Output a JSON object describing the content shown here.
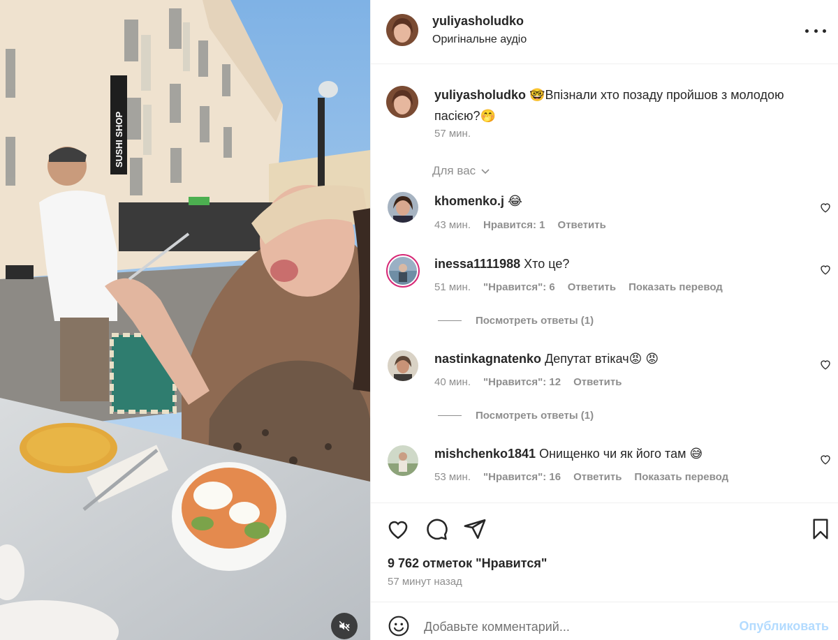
{
  "media": {
    "shop_sign": "SUSHI SHOP",
    "mute_icon": "speaker-muted-icon"
  },
  "header": {
    "username": "yuliyasholudko",
    "audio": "Оригінальне аудіо",
    "more_icon": "more-horizontal-icon"
  },
  "caption": {
    "username": "yuliyasholudko",
    "text": "🤓Впізнали хто позаду пройшов з молодою пасією?🤭",
    "time": "57 мин."
  },
  "for_you_label": "Для вас",
  "comments": [
    {
      "username": "khomenko.j",
      "text": "😂",
      "time": "43 мин.",
      "likes": "Нравится: 1",
      "reply": "Ответить",
      "translate": "",
      "view_replies": ""
    },
    {
      "username": "inessa1111988",
      "text": "Хто це?",
      "time": "51 мин.",
      "likes": "\"Нравится\": 6",
      "reply": "Ответить",
      "translate": "Показать перевод",
      "view_replies": "Посмотреть ответы (1)"
    },
    {
      "username": "nastinkagnatenko",
      "text": "Депутат втікач😡 😡",
      "time": "40 мин.",
      "likes": "\"Нравится\": 12",
      "reply": "Ответить",
      "translate": "",
      "view_replies": "Посмотреть ответы (1)"
    },
    {
      "username": "mishchenko1841",
      "text": "Онищенко чи як його там 😅",
      "time": "53 мин.",
      "likes": "\"Нравится\": 16",
      "reply": "Ответить",
      "translate": "Показать перевод",
      "view_replies": ""
    }
  ],
  "actions": {
    "likes_count": "9 762 отметок \"Нравится\"",
    "time_ago": "57 минут назад"
  },
  "composer": {
    "placeholder": "Добавьте комментарий...",
    "publish": "Опубликовать"
  },
  "colors": {
    "text": "#262626",
    "muted": "#8e8e8e",
    "publish_disabled": "#b3dbff"
  }
}
